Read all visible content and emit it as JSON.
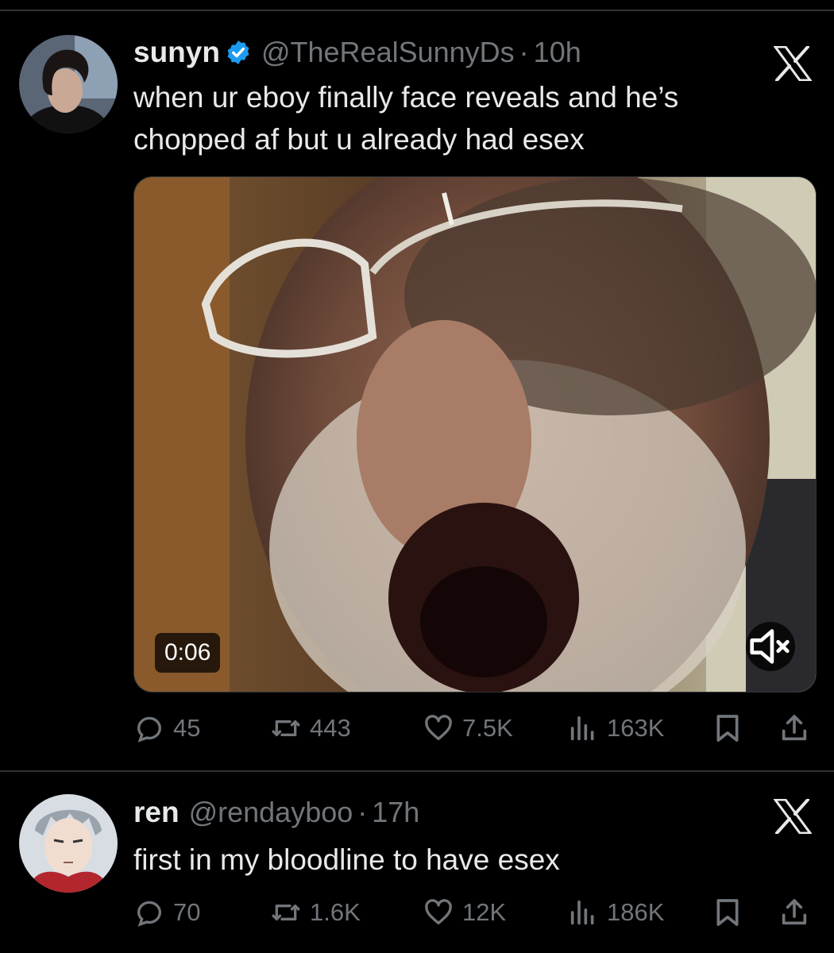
{
  "tweets": [
    {
      "name": "sunyn",
      "verified": true,
      "handle": "@TheRealSunnyDs",
      "separator": "·",
      "time": "10h",
      "text_lines": [
        "when ur eboy finally face reveals and he’s",
        "chopped af but u already had esex"
      ],
      "media": {
        "type": "video",
        "duration": "0:06",
        "muted": true
      },
      "stats": {
        "replies": "45",
        "retweets": "443",
        "likes": "7.5K",
        "views": "163K"
      }
    },
    {
      "name": "ren",
      "verified": false,
      "handle": "@rendayboo",
      "separator": "·",
      "time": "17h",
      "text_lines": [
        "first in my bloodline to have esex"
      ],
      "stats": {
        "replies": "70",
        "retweets": "1.6K",
        "likes": "12K",
        "views": "186K"
      }
    }
  ],
  "icons": [
    "verified-badge-icon",
    "x-logo-icon",
    "reply-icon",
    "retweet-icon",
    "like-icon",
    "views-icon",
    "bookmark-icon",
    "share-icon",
    "mute-icon"
  ],
  "colors": {
    "background": "#000000",
    "text": "#e7e9ea",
    "secondary": "#71767b",
    "verified": "#1d9bf0",
    "divider": "#2f3336"
  }
}
